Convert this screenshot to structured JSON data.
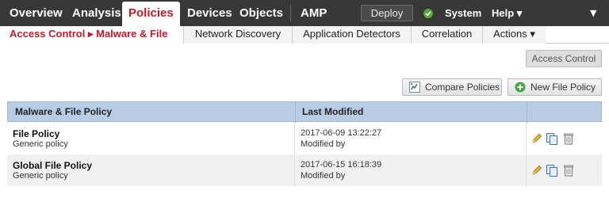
{
  "topnav": {
    "items": [
      "Overview",
      "Analysis",
      "Policies",
      "Devices",
      "Objects",
      "AMP"
    ],
    "active": "Policies",
    "deploy_label": "Deploy",
    "system_label": "System",
    "help_label": "Help ▾",
    "menu_caret": "▼"
  },
  "subnav": {
    "active_label": "Access Control ▸ Malware & File",
    "items": [
      "Network Discovery",
      "Application Detectors",
      "Correlation",
      "Actions ▾"
    ]
  },
  "toolbar": {
    "access_control_label": "Access Control",
    "compare_label": "Compare Policies",
    "new_policy_label": "New File Policy"
  },
  "table": {
    "columns": [
      "Malware & File Policy",
      "Last Modified"
    ],
    "rows": [
      {
        "name": "File Policy",
        "description": "Generic policy",
        "modified": "2017-06-09 13:22:27",
        "modified_by": "Modified by"
      },
      {
        "name": "Global File Policy",
        "description": "Generic policy",
        "modified": "2017-06-15 16:18:39",
        "modified_by": "Modified by"
      }
    ]
  },
  "icons": {
    "edit": "pencil-icon",
    "copy": "copy-icon",
    "delete": "trash-icon",
    "compare": "compare-icon",
    "add": "plus-circle-icon",
    "status": "check-circle-icon"
  },
  "colors": {
    "nav_bg": "#383838",
    "brand_red": "#c41a2b",
    "table_header": "#b8cce6",
    "status_green": "#5aa832"
  }
}
